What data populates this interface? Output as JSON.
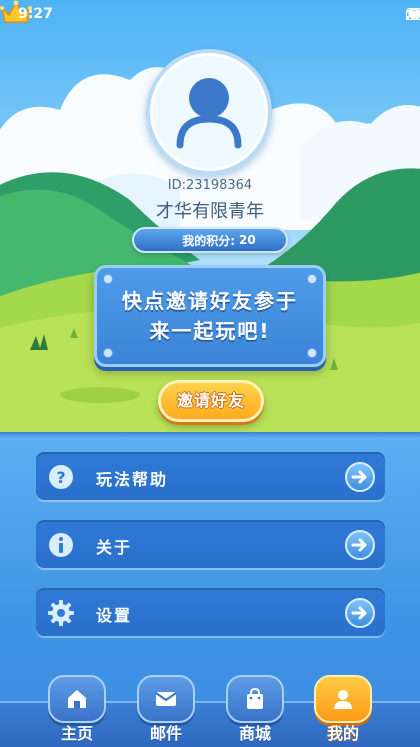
{
  "status_bar": {
    "time": "9:27"
  },
  "profile": {
    "id_text": "ID:23198364",
    "name": "才华有限青年",
    "points_label": "我的积分:",
    "points_value": "20"
  },
  "invite": {
    "message_line1": "快点邀请好友参于",
    "message_line2": "来一起玩吧!",
    "button_label": "邀请好友"
  },
  "menu": {
    "items": [
      {
        "icon": "question-icon",
        "label": "玩法帮助"
      },
      {
        "icon": "info-icon",
        "label": "关于"
      },
      {
        "icon": "gear-icon",
        "label": "设置"
      }
    ]
  },
  "nav": {
    "items": [
      {
        "icon": "home-icon",
        "label": "主页"
      },
      {
        "icon": "mail-icon",
        "label": "邮件"
      },
      {
        "icon": "shop-icon",
        "label": "商城"
      },
      {
        "icon": "user-icon",
        "label": "我的",
        "active": true
      }
    ]
  },
  "colors": {
    "accent_orange": "#ffab1e",
    "menu_blue": "#2f7ad6",
    "sky_blue": "#4fb3f5"
  }
}
